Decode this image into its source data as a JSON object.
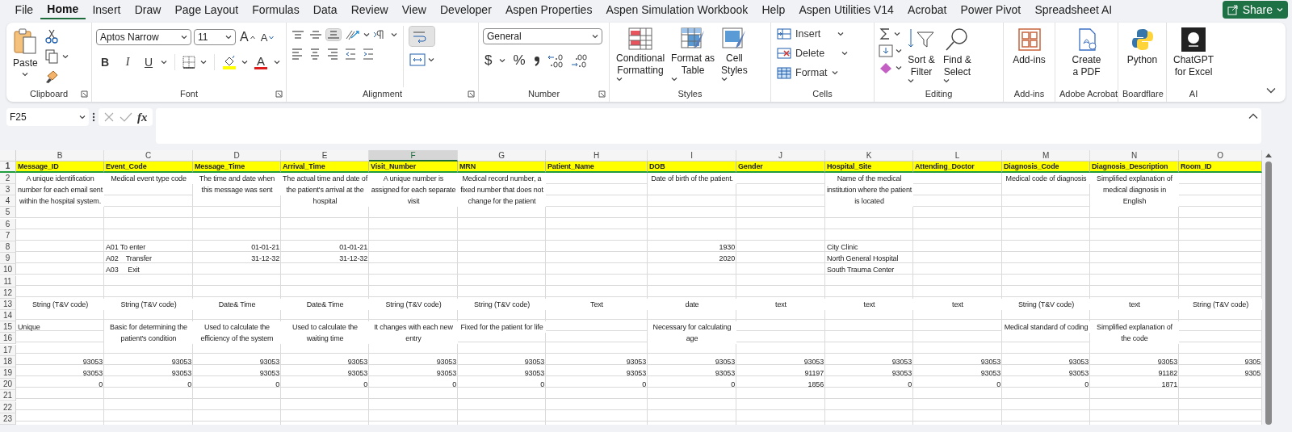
{
  "tabs": [
    {
      "label": "File",
      "selected": false
    },
    {
      "label": "Home",
      "selected": true
    },
    {
      "label": "Insert",
      "selected": false
    },
    {
      "label": "Draw",
      "selected": false
    },
    {
      "label": "Page Layout",
      "selected": false
    },
    {
      "label": "Formulas",
      "selected": false
    },
    {
      "label": "Data",
      "selected": false
    },
    {
      "label": "Review",
      "selected": false
    },
    {
      "label": "View",
      "selected": false
    },
    {
      "label": "Developer",
      "selected": false
    },
    {
      "label": "Aspen Properties",
      "selected": false
    },
    {
      "label": "Aspen Simulation Workbook",
      "selected": false
    },
    {
      "label": "Help",
      "selected": false
    },
    {
      "label": "Aspen Utilities V14",
      "selected": false
    },
    {
      "label": "Acrobat",
      "selected": false
    },
    {
      "label": "Power Pivot",
      "selected": false
    },
    {
      "label": "Spreadsheet AI",
      "selected": false
    }
  ],
  "share_button": {
    "label": "Share"
  },
  "ribbon": {
    "groups": [
      {
        "kind": "clipboard",
        "label": "Clipboard",
        "paste": "Paste"
      },
      {
        "kind": "font",
        "label": "Font",
        "font_name": "Aptos Narrow",
        "font_size": "11",
        "grow": "A",
        "shrink": "A",
        "bold": "B",
        "italic": "I",
        "underline": "U",
        "font_color": "A"
      },
      {
        "kind": "alignment",
        "label": "Alignment",
        "vertical_align": [
          {
            "selected": false
          },
          {
            "selected": false
          },
          {
            "selected": true
          }
        ],
        "wrap_text": {
          "on": true
        }
      },
      {
        "kind": "number",
        "label": "Number",
        "format": "General",
        "currency": "$",
        "percent": "%"
      },
      {
        "kind": "styles",
        "label": "Styles",
        "buttons": [
          {
            "lines": [
              "Conditional",
              "Formatting"
            ]
          },
          {
            "lines": [
              "Format as",
              "Table"
            ]
          },
          {
            "lines": [
              "Cell",
              "Styles"
            ]
          }
        ]
      },
      {
        "kind": "cells",
        "label": "Cells",
        "buttons": [
          {
            "lines": [
              "Insert"
            ]
          },
          {
            "lines": [
              "Delete"
            ]
          },
          {
            "lines": [
              "Format"
            ]
          }
        ]
      },
      {
        "kind": "editing",
        "label": "Editing",
        "buttons": [
          {
            "lines": [
              "Sort &",
              "Filter"
            ]
          },
          {
            "lines": [
              "Find &",
              "Select"
            ]
          }
        ]
      },
      {
        "kind": "addins",
        "label": "Add-ins",
        "button": {
          "lines": [
            "Add-ins"
          ]
        }
      },
      {
        "kind": "acrobat",
        "label": "Adobe Acrobat",
        "button": {
          "lines": [
            "Create",
            "a PDF"
          ]
        }
      },
      {
        "kind": "python",
        "label": "Boardflare",
        "button": {
          "lines": [
            "Python"
          ]
        }
      },
      {
        "kind": "chatgpt",
        "label": "AI",
        "button": {
          "lines": [
            "ChatGPT",
            "for Excel"
          ]
        }
      }
    ]
  },
  "formula_bar": {
    "name_box": "F25",
    "fx": "fx"
  },
  "sheet": {
    "columns": [
      {
        "letter": "B",
        "selected": false
      },
      {
        "letter": "C",
        "selected": false
      },
      {
        "letter": "D",
        "selected": false
      },
      {
        "letter": "E",
        "selected": false
      },
      {
        "letter": "F",
        "selected": true
      },
      {
        "letter": "G",
        "selected": false
      },
      {
        "letter": "H",
        "selected": false
      },
      {
        "letter": "I",
        "selected": false
      },
      {
        "letter": "J",
        "selected": false
      },
      {
        "letter": "K",
        "selected": false
      },
      {
        "letter": "L",
        "selected": false
      },
      {
        "letter": "M",
        "selected": false
      },
      {
        "letter": "N",
        "selected": false
      },
      {
        "letter": "O",
        "selected": false
      }
    ],
    "row_groups": [
      {
        "kind": "header",
        "rows": [
          "1"
        ],
        "cells": [
          {
            "kind": "title",
            "text": "Message_ID"
          },
          {
            "kind": "title",
            "text": "Event_Code"
          },
          {
            "kind": "title",
            "text": "Message_Time"
          },
          {
            "kind": "title",
            "text": "Arrival_Time"
          },
          {
            "kind": "title",
            "text": "Visit_Number"
          },
          {
            "kind": "title",
            "text": "MRN"
          },
          {
            "kind": "title",
            "text": "Patient_Name"
          },
          {
            "kind": "title",
            "text": "DOB"
          },
          {
            "kind": "title",
            "text": "Gender"
          },
          {
            "kind": "title",
            "text": "Hospital_Site"
          },
          {
            "kind": "title",
            "text": "Attending_Doctor"
          },
          {
            "kind": "title",
            "text": "Diagnosis_Code"
          },
          {
            "kind": "title",
            "text": "Diagnosis_Description"
          },
          {
            "kind": "title",
            "text": "Room_ID"
          }
        ]
      },
      {
        "kind": "body",
        "rows": [
          "2",
          "3",
          "4",
          "5"
        ],
        "cells": [
          {
            "kind": "note",
            "text": "A unique identification number for each email sent within the hospital system."
          },
          {
            "kind": "note",
            "text": "Medical event type code"
          },
          {
            "kind": "note",
            "text": "The time and date when this message was sent"
          },
          {
            "kind": "note",
            "text": "The actual time and date of the patient's arrival at the hospital"
          },
          {
            "kind": "note",
            "text": "A unique number is assigned for each separate visit"
          },
          {
            "kind": "note",
            "text": "Medical record number, a fixed number that does not change for the patient"
          },
          null,
          {
            "kind": "note",
            "text": "Date of birth of the patient."
          },
          null,
          {
            "kind": "note",
            "text": "Name of the medical institution where the patient is located"
          },
          null,
          {
            "kind": "note",
            "text": "Medical code of diagnosis"
          },
          {
            "kind": "note",
            "text": "Simplified explanation of medical diagnosis in English"
          },
          null
        ]
      },
      {
        "kind": "body",
        "rows": [
          "6"
        ]
      },
      {
        "kind": "body",
        "rows": [
          "7"
        ]
      },
      {
        "kind": "body",
        "rows": [
          "8"
        ],
        "cells": [
          null,
          {
            "kind": "label",
            "text": "A01 To enter"
          },
          {
            "kind": "number",
            "text": "01-01-21"
          },
          {
            "kind": "number",
            "text": "01-01-21"
          },
          null,
          null,
          null,
          {
            "kind": "number",
            "text": "1930"
          },
          null,
          {
            "kind": "label",
            "text": "City Clinic"
          },
          null,
          null,
          null,
          null
        ]
      },
      {
        "kind": "body",
        "rows": [
          "9"
        ],
        "cells": [
          null,
          {
            "kind": "label",
            "text": "A02    Transfer"
          },
          {
            "kind": "number",
            "text": "31-12-32"
          },
          {
            "kind": "number",
            "text": "31-12-32"
          },
          null,
          null,
          null,
          {
            "kind": "number",
            "text": "2020"
          },
          null,
          {
            "kind": "label",
            "text": "North General Hospital"
          },
          null,
          null,
          null,
          null
        ]
      },
      {
        "kind": "body",
        "rows": [
          "10"
        ],
        "cells": [
          null,
          {
            "kind": "label",
            "text": "A03     Exit"
          },
          null,
          null,
          null,
          null,
          null,
          null,
          null,
          {
            "kind": "label",
            "text": "South Trauma Center"
          },
          null,
          null,
          null,
          null
        ]
      },
      {
        "kind": "body",
        "rows": [
          "11"
        ]
      },
      {
        "kind": "body",
        "rows": [
          "12"
        ]
      },
      {
        "kind": "body",
        "rows": [
          "13"
        ],
        "cells": [
          {
            "kind": "note",
            "text": "String (T&V code)"
          },
          {
            "kind": "note",
            "text": "String (T&V code)"
          },
          {
            "kind": "note",
            "text": "Date& Time"
          },
          {
            "kind": "note",
            "text": "Date& Time"
          },
          {
            "kind": "note",
            "text": "String (T&V code)"
          },
          {
            "kind": "note",
            "text": "String (T&V code)"
          },
          {
            "kind": "note",
            "text": "Text"
          },
          {
            "kind": "note",
            "text": "date"
          },
          {
            "kind": "note",
            "text": "text"
          },
          {
            "kind": "note",
            "text": "text"
          },
          {
            "kind": "note",
            "text": "text"
          },
          {
            "kind": "note",
            "text": "String (T&V code)"
          },
          {
            "kind": "note",
            "text": "text"
          },
          {
            "kind": "note",
            "text": "String (T&V code)"
          }
        ]
      },
      {
        "kind": "body",
        "rows": [
          "14"
        ]
      },
      {
        "kind": "body",
        "rows": [
          "15",
          "16"
        ],
        "cells": [
          {
            "kind": "label",
            "text": "Unique"
          },
          {
            "kind": "note",
            "text": "Basic for determining the patient's condition"
          },
          {
            "kind": "note",
            "text": "Used to calculate the efficiency of the system"
          },
          {
            "kind": "note",
            "text": "Used to calculate the waiting time"
          },
          {
            "kind": "note",
            "text": "It changes with each new entry"
          },
          {
            "kind": "note",
            "text": "Fixed for the patient for life"
          },
          null,
          {
            "kind": "note",
            "text": "Necessary for calculating age"
          },
          null,
          null,
          null,
          {
            "kind": "note",
            "text": "Medical standard of coding"
          },
          {
            "kind": "note",
            "text": "Simplified explanation of the code"
          },
          null
        ]
      },
      {
        "kind": "body",
        "rows": [
          "17"
        ]
      },
      {
        "kind": "body",
        "rows": [
          "18"
        ],
        "cells": [
          {
            "kind": "number",
            "text": "93053"
          },
          {
            "kind": "number",
            "text": "93053"
          },
          {
            "kind": "number",
            "text": "93053"
          },
          {
            "kind": "number",
            "text": "93053"
          },
          {
            "kind": "number",
            "text": "93053"
          },
          {
            "kind": "number",
            "text": "93053"
          },
          {
            "kind": "number",
            "text": "93053"
          },
          {
            "kind": "number",
            "text": "93053"
          },
          {
            "kind": "number",
            "text": "93053"
          },
          {
            "kind": "number",
            "text": "93053"
          },
          {
            "kind": "number",
            "text": "93053"
          },
          {
            "kind": "number",
            "text": "93053"
          },
          {
            "kind": "number",
            "text": "93053"
          },
          {
            "kind": "number",
            "text": "9305"
          }
        ]
      },
      {
        "kind": "body",
        "rows": [
          "19"
        ],
        "cells": [
          {
            "kind": "number",
            "text": "93053"
          },
          {
            "kind": "number",
            "text": "93053"
          },
          {
            "kind": "number",
            "text": "93053"
          },
          {
            "kind": "number",
            "text": "93053"
          },
          {
            "kind": "number",
            "text": "93053"
          },
          {
            "kind": "number",
            "text": "93053"
          },
          {
            "kind": "number",
            "text": "93053"
          },
          {
            "kind": "number",
            "text": "93053"
          },
          {
            "kind": "number",
            "text": "91197"
          },
          {
            "kind": "number",
            "text": "93053"
          },
          {
            "kind": "number",
            "text": "93053"
          },
          {
            "kind": "number",
            "text": "93053"
          },
          {
            "kind": "number",
            "text": "91182"
          },
          {
            "kind": "number",
            "text": "9305"
          }
        ]
      },
      {
        "kind": "body",
        "rows": [
          "20"
        ],
        "cells": [
          {
            "kind": "number",
            "text": "0"
          },
          {
            "kind": "number",
            "text": "0"
          },
          {
            "kind": "number",
            "text": "0"
          },
          {
            "kind": "number",
            "text": "0"
          },
          {
            "kind": "number",
            "text": "0"
          },
          {
            "kind": "number",
            "text": "0"
          },
          {
            "kind": "number",
            "text": "0"
          },
          {
            "kind": "number",
            "text": "0"
          },
          {
            "kind": "number",
            "text": "1856"
          },
          {
            "kind": "number",
            "text": "0"
          },
          {
            "kind": "number",
            "text": "0"
          },
          {
            "kind": "number",
            "text": "0"
          },
          {
            "kind": "number",
            "text": "1871"
          },
          null
        ]
      },
      {
        "kind": "body",
        "rows": [
          "21"
        ]
      },
      {
        "kind": "body",
        "rows": [
          "22"
        ]
      },
      {
        "kind": "body",
        "rows": [
          "23"
        ]
      }
    ]
  }
}
